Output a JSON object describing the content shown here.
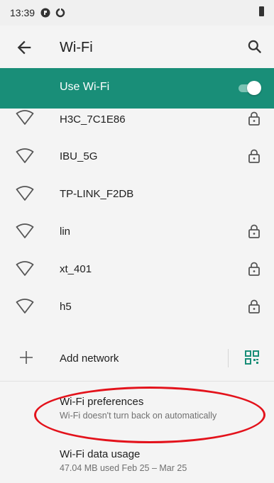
{
  "status_bar": {
    "time": "13:39"
  },
  "app_bar": {
    "title": "Wi-Fi"
  },
  "use_wifi": {
    "label": "Use Wi-Fi",
    "enabled": true
  },
  "networks": [
    {
      "name": "H3C_7C1E86",
      "locked": true
    },
    {
      "name": "IBU_5G",
      "locked": true
    },
    {
      "name": "TP-LINK_F2DB",
      "locked": false
    },
    {
      "name": "lin",
      "locked": true
    },
    {
      "name": "xt_401",
      "locked": true
    },
    {
      "name": "h5",
      "locked": true
    }
  ],
  "add_network": {
    "label": "Add network"
  },
  "preferences": {
    "title": "Wi-Fi preferences",
    "subtitle": "Wi-Fi doesn't turn back on automatically"
  },
  "data_usage": {
    "title": "Wi-Fi data usage",
    "subtitle": "47.04 MB used Feb 25 – Mar 25"
  },
  "colors": {
    "accent": "#198e78",
    "highlight": "#e3121b"
  }
}
